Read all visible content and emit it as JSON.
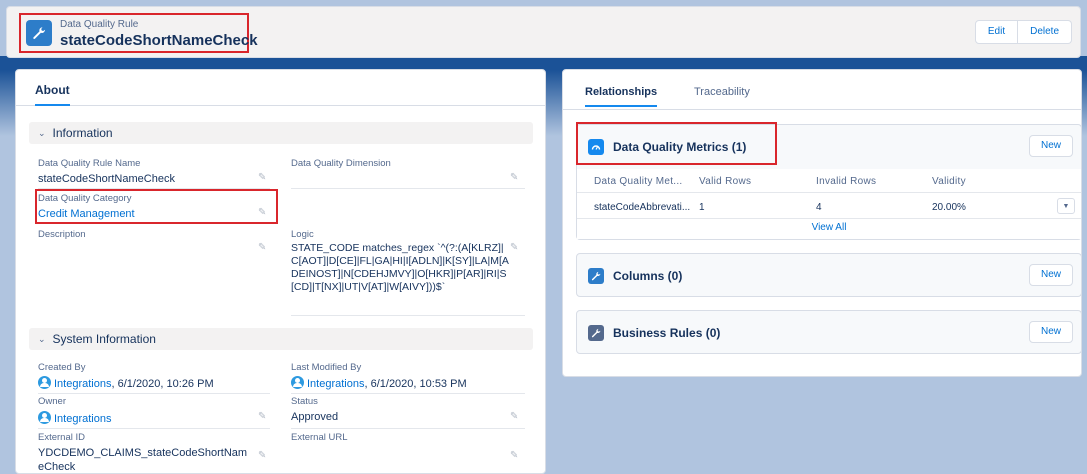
{
  "header": {
    "object_type": "Data Quality Rule",
    "record_name": "stateCodeShortNameCheck",
    "edit_label": "Edit",
    "delete_label": "Delete",
    "icon": "wrench-icon"
  },
  "left": {
    "tab_about": "About",
    "information": {
      "title": "Information",
      "rule_name_label": "Data Quality Rule Name",
      "rule_name_value": "stateCodeShortNameCheck",
      "dimension_label": "Data Quality Dimension",
      "dimension_value": "",
      "category_label": "Data Quality Category",
      "category_value": "Credit Management",
      "description_label": "Description",
      "description_value": "",
      "logic_label": "Logic",
      "logic_value": "STATE_CODE matches_regex `^(?:(A[KLRZ]|C[AOT]|D[CE]|FL|GA|HI|I[ADLN]|K[SY]|LA|M[ADEINOST]|N[CDEHJMVY]|O[HKR]|P[AR]|RI|S[CD]|T[NX]|UT|V[AT]|W[AIVY]))$`"
    },
    "system": {
      "title": "System Information",
      "created_by_label": "Created By",
      "created_by_user": "Integrations",
      "created_by_date": ", 6/1/2020, 10:26 PM",
      "modified_label": "Last Modified By",
      "modified_user": "Integrations",
      "modified_date": ", 6/1/2020, 10:53 PM",
      "owner_label": "Owner",
      "owner_value": "Integrations",
      "status_label": "Status",
      "status_value": "Approved",
      "external_id_label": "External ID",
      "external_id_value": "YDCDEMO_CLAIMS_stateCodeShortNameCheck",
      "external_url_label": "External URL",
      "external_url_value": ""
    }
  },
  "right": {
    "tab_relationships": "Relationships",
    "tab_traceability": "Traceability",
    "metrics": {
      "title": "Data Quality Metrics (1)",
      "new_label": "New",
      "columns": [
        "Data Quality Met...",
        "Valid Rows",
        "Invalid Rows",
        "Validity"
      ],
      "rows": [
        [
          "stateCodeAbbrevati...",
          "1",
          "4",
          "20.00%"
        ]
      ],
      "view_all": "View All",
      "icon": "gauge-icon"
    },
    "columns_card": {
      "title": "Columns (0)",
      "new_label": "New",
      "icon": "wrench-icon"
    },
    "business_rules_card": {
      "title": "Business Rules (0)",
      "new_label": "New",
      "icon": "wrench-icon"
    }
  },
  "colors": {
    "accent": "#0070d2",
    "highlight": "#d9262c",
    "icon_blue": "#2d7dc9",
    "icon_metrics": "#1589ee",
    "icon_dark": "#54698d"
  }
}
